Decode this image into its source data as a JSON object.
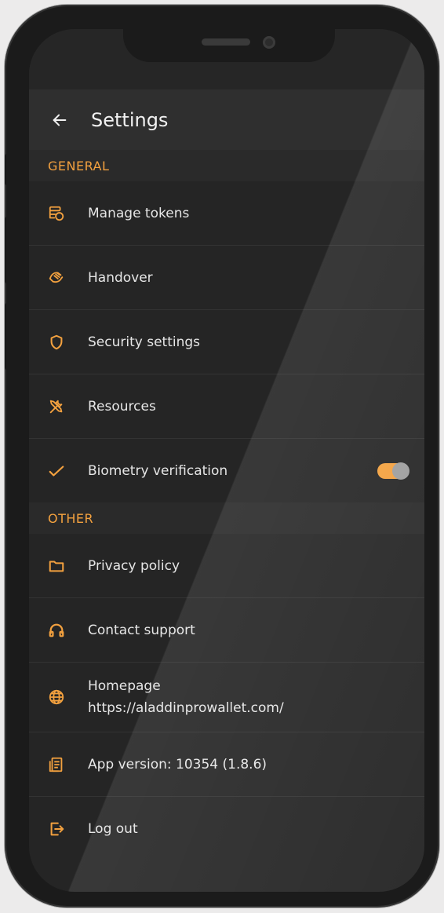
{
  "header": {
    "title": "Settings"
  },
  "sections": {
    "general": "GENERAL",
    "other": "OTHER"
  },
  "items": {
    "manage_tokens": "Manage tokens",
    "handover": "Handover",
    "security_settings": "Security settings",
    "resources": "Resources",
    "biometry": "Biometry verification",
    "privacy_policy": "Privacy policy",
    "contact_support": "Contact support",
    "homepage": "Homepage",
    "homepage_url": "https://aladdinprowallet.com/",
    "app_version": "App version: 10354 (1.8.6)",
    "log_out": "Log out"
  },
  "toggles": {
    "biometry_enabled": true
  },
  "colors": {
    "accent": "#f3a13f",
    "background": "#252525",
    "appbar": "#2f2f2f"
  },
  "icons": {
    "manage_tokens": "tokens-icon",
    "handover": "handshake-icon",
    "security_settings": "shield-icon",
    "resources": "tools-icon",
    "biometry": "check-icon",
    "privacy_policy": "folder-icon",
    "contact_support": "headset-icon",
    "homepage": "globe-icon",
    "app_version": "document-icon",
    "log_out": "logout-icon"
  }
}
